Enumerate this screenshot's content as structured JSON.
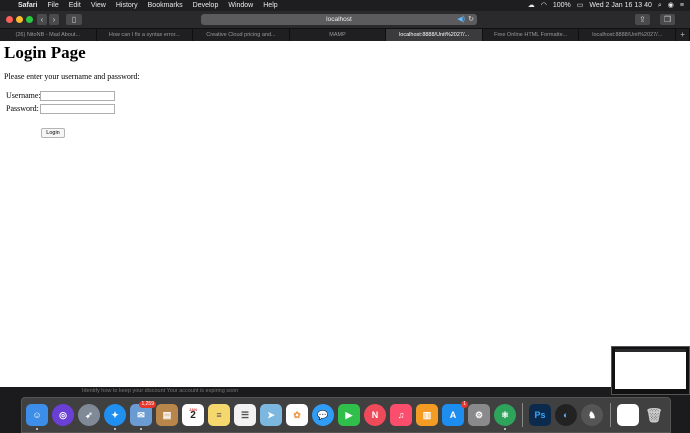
{
  "menubar": {
    "apple": "",
    "app": "Safari",
    "items": [
      "File",
      "Edit",
      "View",
      "History",
      "Bookmarks",
      "Develop",
      "Window",
      "Help"
    ],
    "battery": "100%",
    "datetime": "Wed 2 Jan  16 13 40"
  },
  "browser": {
    "address": "localhost",
    "tabs": [
      "(26) NitoNB - Mad About...",
      "How can I fix a syntax error...",
      "Creative Cloud pricing and...",
      "MAMP",
      "localhost:8888/Unit%2027/...",
      "Free Online HTML Formatte...",
      "localhost:8888/Unit%2027/..."
    ],
    "active_tab": 4,
    "new_tab": "+"
  },
  "page": {
    "title": "Login Page",
    "intro": "Please enter your username and password:",
    "username_label": "Username:",
    "password_label": "Password:",
    "username_value": "",
    "password_value": "",
    "login_button": "Login"
  },
  "background_text": "Identify how to keep your discount Your account is expiring soon",
  "dock": {
    "calendar_month": "JAN",
    "calendar_day": "2",
    "mail_badge": "1,259",
    "appstore_badge": "1"
  }
}
